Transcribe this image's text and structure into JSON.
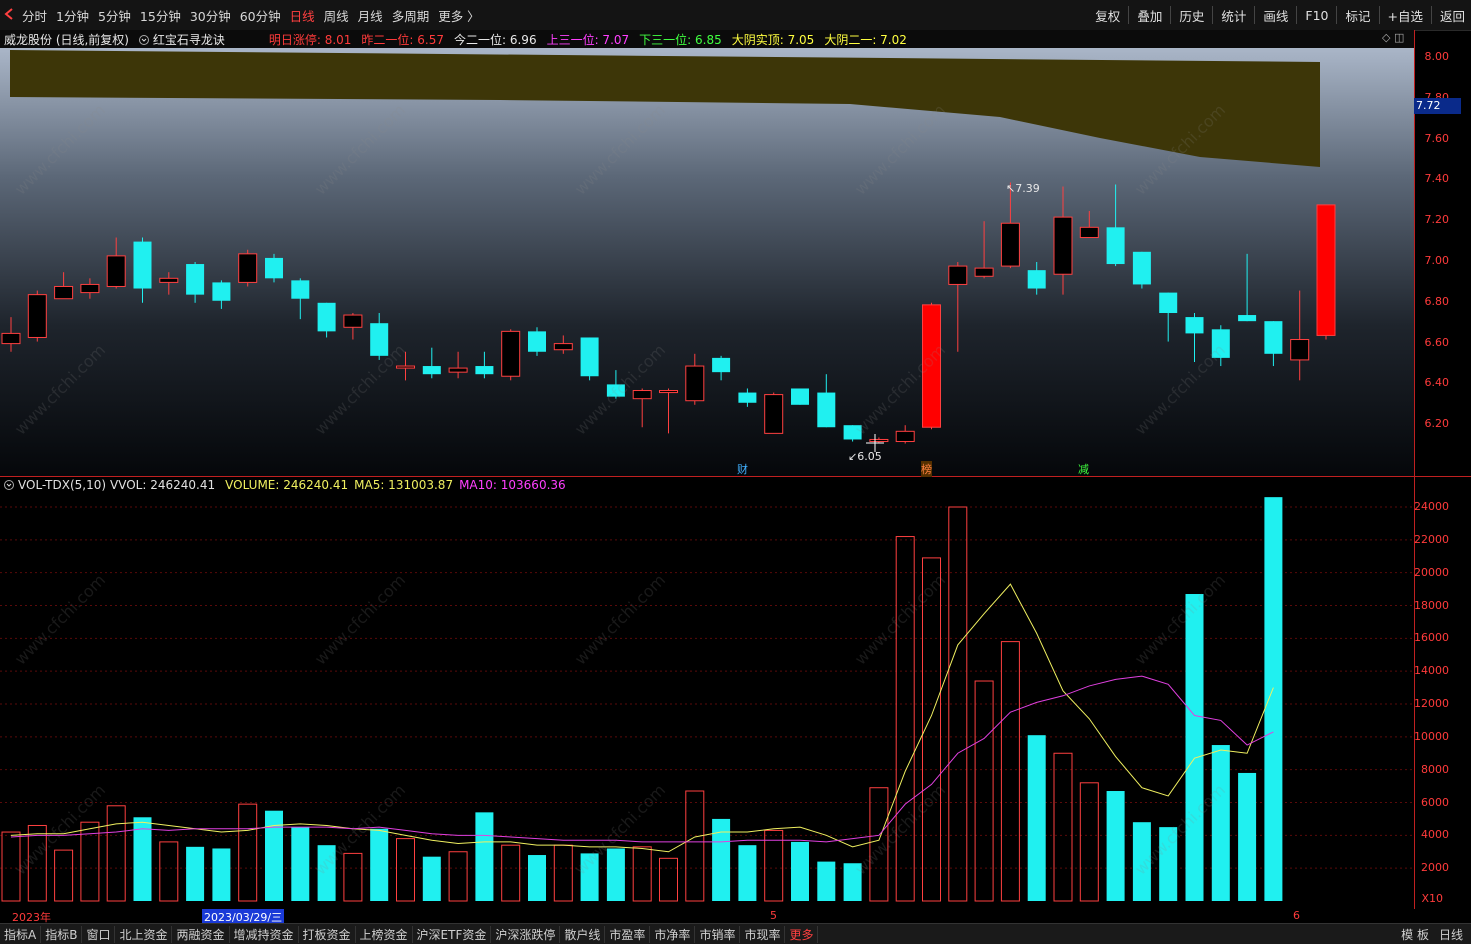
{
  "toolbar": {
    "tabs": [
      "分时",
      "1分钟",
      "5分钟",
      "15分钟",
      "30分钟",
      "60分钟",
      "日线",
      "周线",
      "月线",
      "多周期",
      "更多 〉"
    ],
    "active_tab": "日线",
    "right_buttons": [
      "复权",
      "叠加",
      "历史",
      "统计",
      "画线",
      "F10",
      "标记",
      "+自选",
      "返回"
    ]
  },
  "info": {
    "stock": "威龙股份 (日线,前复权)",
    "indicator": "红宝石寻龙诀",
    "items": [
      {
        "text": "明日涨停: 8.01",
        "color": "#ff3b3b"
      },
      {
        "text": "昨二一位: 6.57",
        "color": "#ff3b3b"
      },
      {
        "text": "今二一位: 6.96",
        "color": "#e8e8e8"
      },
      {
        "text": "上三一位: 7.07",
        "color": "#ff40ff"
      },
      {
        "text": "下三一位: 6.85",
        "color": "#40ff40"
      },
      {
        "text": "大阴实顶: 7.05",
        "color": "#ffff40"
      },
      {
        "text": "大阴二一: 7.02",
        "color": "#ffff40"
      }
    ]
  },
  "price_axis": {
    "ticks": [
      "8.00",
      "7.80",
      "7.60",
      "7.40",
      "7.20",
      "7.00",
      "6.80",
      "6.60",
      "6.40",
      "6.20"
    ],
    "current_price": "7.72"
  },
  "annotations": {
    "high_label": "7.39",
    "low_label": "6.05",
    "markers": [
      {
        "text": "财",
        "color": "#40b0ff"
      },
      {
        "text": "榜",
        "color": "#ff8040"
      },
      {
        "text": "减",
        "color": "#40ff40"
      }
    ]
  },
  "volume_info": {
    "name": "VOL-TDX(5,10)",
    "vvol": "VVOL: 246240.41",
    "volume": "VOLUME: 246240.41",
    "ma5": "MA5: 131003.87",
    "ma10": "MA10: 103660.36"
  },
  "volume_axis": {
    "ticks": [
      "24000",
      "22000",
      "20000",
      "18000",
      "16000",
      "14000",
      "12000",
      "10000",
      "8000",
      "6000",
      "4000",
      "2000"
    ],
    "unit": "X10"
  },
  "date_axis": {
    "year": "2023年",
    "cursor_date": "2023/03/29/三",
    "month5": "5",
    "month6": "6"
  },
  "bottom": {
    "tabs": [
      "指标A",
      "指标B",
      "窗口",
      "北上资金",
      "两融资金",
      "增减持资金",
      "打板资金",
      "上榜资金",
      "沪深ETF资金",
      "沪深涨跌停",
      "散户线",
      "市盈率",
      "市净率",
      "市销率",
      "市现率",
      "更多"
    ],
    "right": [
      "模 板",
      "日线"
    ]
  },
  "watermark": "www.cfchi.com",
  "chart_data": {
    "type": "candlestick",
    "candles": [
      {
        "o": 6.6,
        "c": 6.65,
        "h": 6.73,
        "l": 6.56,
        "up": false
      },
      {
        "o": 6.63,
        "c": 6.84,
        "h": 6.86,
        "l": 6.61,
        "up": true
      },
      {
        "o": 6.82,
        "c": 6.88,
        "h": 6.95,
        "l": 6.82,
        "up": true
      },
      {
        "o": 6.85,
        "c": 6.89,
        "h": 6.92,
        "l": 6.82,
        "up": true
      },
      {
        "o": 6.88,
        "c": 7.03,
        "h": 7.12,
        "l": 6.87,
        "up": true
      },
      {
        "o": 7.1,
        "c": 6.87,
        "h": 7.12,
        "l": 6.8,
        "up": false
      },
      {
        "o": 6.9,
        "c": 6.92,
        "h": 6.95,
        "l": 6.84,
        "up": true
      },
      {
        "o": 6.99,
        "c": 6.84,
        "h": 7.0,
        "l": 6.8,
        "up": false
      },
      {
        "o": 6.9,
        "c": 6.81,
        "h": 6.91,
        "l": 6.77,
        "up": false
      },
      {
        "o": 6.9,
        "c": 7.04,
        "h": 7.06,
        "l": 6.88,
        "up": true
      },
      {
        "o": 7.02,
        "c": 6.92,
        "h": 7.04,
        "l": 6.9,
        "up": false
      },
      {
        "o": 6.91,
        "c": 6.82,
        "h": 6.92,
        "l": 6.72,
        "up": false
      },
      {
        "o": 6.8,
        "c": 6.66,
        "h": 6.8,
        "l": 6.63,
        "up": false
      },
      {
        "o": 6.68,
        "c": 6.74,
        "h": 6.75,
        "l": 6.62,
        "up": true
      },
      {
        "o": 6.7,
        "c": 6.54,
        "h": 6.75,
        "l": 6.52,
        "up": false
      },
      {
        "o": 6.48,
        "c": 6.49,
        "h": 6.56,
        "l": 6.42,
        "up": true
      },
      {
        "o": 6.49,
        "c": 6.45,
        "h": 6.58,
        "l": 6.43,
        "up": false
      },
      {
        "o": 6.46,
        "c": 6.48,
        "h": 6.56,
        "l": 6.43,
        "up": true
      },
      {
        "o": 6.49,
        "c": 6.45,
        "h": 6.56,
        "l": 6.43,
        "up": false
      },
      {
        "o": 6.44,
        "c": 6.66,
        "h": 6.67,
        "l": 6.42,
        "up": true
      },
      {
        "o": 6.66,
        "c": 6.56,
        "h": 6.68,
        "l": 6.54,
        "up": false
      },
      {
        "o": 6.57,
        "c": 6.6,
        "h": 6.64,
        "l": 6.55,
        "up": true
      },
      {
        "o": 6.63,
        "c": 6.44,
        "h": 6.63,
        "l": 6.42,
        "up": false
      },
      {
        "o": 6.4,
        "c": 6.34,
        "h": 6.47,
        "l": 6.33,
        "up": false
      },
      {
        "o": 6.33,
        "c": 6.37,
        "h": 6.38,
        "l": 6.19,
        "up": true
      },
      {
        "o": 6.36,
        "c": 6.37,
        "h": 6.38,
        "l": 6.16,
        "up": true
      },
      {
        "o": 6.32,
        "c": 6.49,
        "h": 6.55,
        "l": 6.3,
        "up": true
      },
      {
        "o": 6.53,
        "c": 6.46,
        "h": 6.54,
        "l": 6.42,
        "up": false
      },
      {
        "o": 6.36,
        "c": 6.31,
        "h": 6.38,
        "l": 6.29,
        "up": false
      },
      {
        "o": 6.16,
        "c": 6.35,
        "h": 6.36,
        "l": 6.16,
        "up": true
      },
      {
        "o": 6.38,
        "c": 6.3,
        "h": 6.38,
        "l": 6.3,
        "up": true
      },
      {
        "o": 6.36,
        "c": 6.19,
        "h": 6.45,
        "l": 6.19,
        "up": false
      },
      {
        "o": 6.2,
        "c": 6.13,
        "h": 6.2,
        "l": 6.12,
        "up": false
      },
      {
        "o": 6.12,
        "c": 6.13,
        "h": 6.14,
        "l": 6.11,
        "up": false
      },
      {
        "o": 6.12,
        "c": 6.17,
        "h": 6.2,
        "l": 6.11,
        "up": true
      },
      {
        "o": 6.19,
        "c": 6.79,
        "h": 6.8,
        "l": 6.18,
        "up": true
      },
      {
        "o": 6.89,
        "c": 6.98,
        "h": 7.0,
        "l": 6.56,
        "up": false
      },
      {
        "o": 6.93,
        "c": 6.97,
        "h": 7.2,
        "l": 6.92,
        "up": true
      },
      {
        "o": 6.98,
        "c": 7.19,
        "h": 7.39,
        "l": 6.97,
        "up": true
      },
      {
        "o": 6.96,
        "c": 6.87,
        "h": 7.0,
        "l": 6.84,
        "up": false
      },
      {
        "o": 6.94,
        "c": 7.22,
        "h": 7.37,
        "l": 6.84,
        "up": true
      },
      {
        "o": 7.12,
        "c": 7.17,
        "h": 7.25,
        "l": 7.12,
        "up": true
      },
      {
        "o": 7.17,
        "c": 6.99,
        "h": 7.38,
        "l": 6.98,
        "up": false
      },
      {
        "o": 7.05,
        "c": 6.89,
        "h": 7.05,
        "l": 6.87,
        "up": false
      },
      {
        "o": 6.85,
        "c": 6.75,
        "h": 6.85,
        "l": 6.61,
        "up": false
      },
      {
        "o": 6.73,
        "c": 6.65,
        "h": 6.75,
        "l": 6.51,
        "up": false
      },
      {
        "o": 6.67,
        "c": 6.53,
        "h": 6.69,
        "l": 6.49,
        "up": false
      },
      {
        "o": 6.74,
        "c": 6.71,
        "h": 7.04,
        "l": 6.71,
        "up": false
      },
      {
        "o": 6.71,
        "c": 6.55,
        "h": 6.71,
        "l": 6.49,
        "up": false
      },
      {
        "o": 6.52,
        "c": 6.62,
        "h": 6.86,
        "l": 6.42,
        "up": true
      },
      {
        "o": 6.64,
        "c": 7.28,
        "h": 7.28,
        "l": 6.62,
        "up": true
      }
    ],
    "volume": [
      4200,
      4600,
      3100,
      4800,
      5800,
      5100,
      3600,
      3300,
      3200,
      5900,
      5500,
      4500,
      3400,
      2900,
      4400,
      3800,
      2700,
      3000,
      5400,
      3400,
      2800,
      3400,
      2900,
      3200,
      3300,
      2600,
      6700,
      5000,
      3400,
      4300,
      3600,
      2400,
      2300,
      6900,
      22200,
      20900,
      24000,
      13400,
      15800,
      10100,
      9000,
      7200,
      6700,
      4800,
      4500,
      18700,
      9500,
      7800,
      24600
    ],
    "ma5": [
      4000,
      4100,
      4100,
      4400,
      4700,
      4800,
      4600,
      4400,
      4200,
      4300,
      4600,
      4700,
      4600,
      4400,
      4300,
      4000,
      3700,
      3500,
      3600,
      3600,
      3400,
      3400,
      3300,
      3300,
      3200,
      3000,
      3900,
      4200,
      4200,
      4400,
      4500,
      4000,
      3300,
      3700,
      7900,
      11300,
      15600,
      17500,
      19300,
      16300,
      12800,
      11100,
      8800,
      6900,
      6400,
      8700,
      9200,
      9000,
      13000
    ],
    "ma10": [
      3900,
      4000,
      4000,
      4100,
      4200,
      4400,
      4300,
      4400,
      4400,
      4400,
      4500,
      4500,
      4500,
      4400,
      4500,
      4300,
      4100,
      4000,
      4000,
      3900,
      3800,
      3700,
      3700,
      3700,
      3600,
      3600,
      3600,
      3600,
      3700,
      3700,
      3700,
      3600,
      3800,
      4000,
      5900,
      7100,
      9000,
      9900,
      11500,
      12100,
      12500,
      13100,
      13500,
      13700,
      13200,
      11300,
      11000,
      9500,
      10300
    ]
  }
}
